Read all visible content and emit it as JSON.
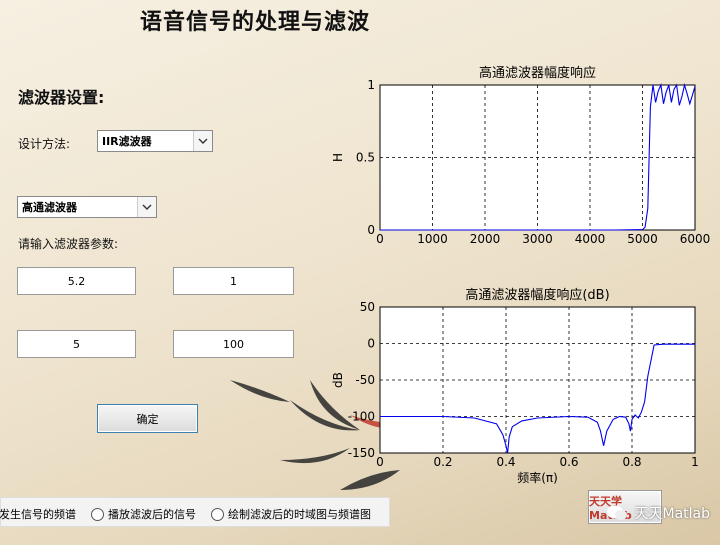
{
  "title": "语音信号的处理与滤波",
  "panel": {
    "section_title": "滤波器设置:",
    "design_method_label": "设计方法:",
    "design_method_value": "IIR滤波器",
    "filter_type_value": "高通滤波器",
    "params_label": "请输入滤波器参数:",
    "params": [
      "5.2",
      "1",
      "5",
      "100"
    ],
    "ok_button": "确定"
  },
  "radios": [
    "发生信号的频谱",
    "播放滤波后的信号",
    "绘制滤波后的时域图与频谱图"
  ],
  "corner_button": "天天学Matlab",
  "watermark": "天天Matlab",
  "chart_data": [
    {
      "type": "line",
      "title": "高通滤波器幅度响应",
      "xlabel": "",
      "ylabel": "H",
      "xlim": [
        0,
        6000
      ],
      "ylim": [
        0,
        1
      ],
      "xticks": [
        "0",
        "1000",
        "2000",
        "3000",
        "4000",
        "5000",
        "6000"
      ],
      "yticks": [
        "0",
        "0.5",
        "1"
      ],
      "grid": true,
      "x": [
        0,
        4500,
        5000,
        5050,
        5100,
        5150,
        5200,
        5250,
        5300,
        5350,
        5400,
        5450,
        5500,
        5550,
        5600,
        5650,
        5700,
        5750,
        5800,
        5850,
        5900,
        5950,
        6000
      ],
      "y": [
        0,
        0,
        0.003,
        0.02,
        0.15,
        0.85,
        1.0,
        0.88,
        0.96,
        1.0,
        0.87,
        0.95,
        1.0,
        0.88,
        0.97,
        1.0,
        0.86,
        0.92,
        1.0,
        0.94,
        0.87,
        0.93,
        0.99
      ],
      "color": "#0000ee"
    },
    {
      "type": "line",
      "title": "高通滤波器幅度响应(dB)",
      "xlabel": "频率(π)",
      "ylabel": "dB",
      "xlim": [
        0,
        1
      ],
      "ylim": [
        -150,
        50
      ],
      "xticks": [
        "0",
        "0.2",
        "0.4",
        "0.6",
        "0.8",
        "1"
      ],
      "yticks": [
        "50",
        "0",
        "-50",
        "-100",
        "-150"
      ],
      "grid": true,
      "x": [
        0,
        0.2,
        0.3,
        0.37,
        0.39,
        0.4,
        0.405,
        0.41,
        0.42,
        0.45,
        0.5,
        0.6,
        0.66,
        0.69,
        0.7,
        0.71,
        0.72,
        0.74,
        0.76,
        0.78,
        0.79,
        0.795,
        0.8,
        0.81,
        0.82,
        0.83,
        0.84,
        0.85,
        0.87,
        0.9,
        1.0
      ],
      "y": [
        -100,
        -100,
        -102,
        -110,
        -125,
        -140,
        -150,
        -128,
        -114,
        -106,
        -102,
        -100,
        -101,
        -108,
        -120,
        -140,
        -120,
        -104,
        -100,
        -101,
        -110,
        -120,
        -104,
        -98,
        -102,
        -94,
        -80,
        -45,
        -2,
        -1,
        -1
      ],
      "color": "#0000ee"
    }
  ]
}
